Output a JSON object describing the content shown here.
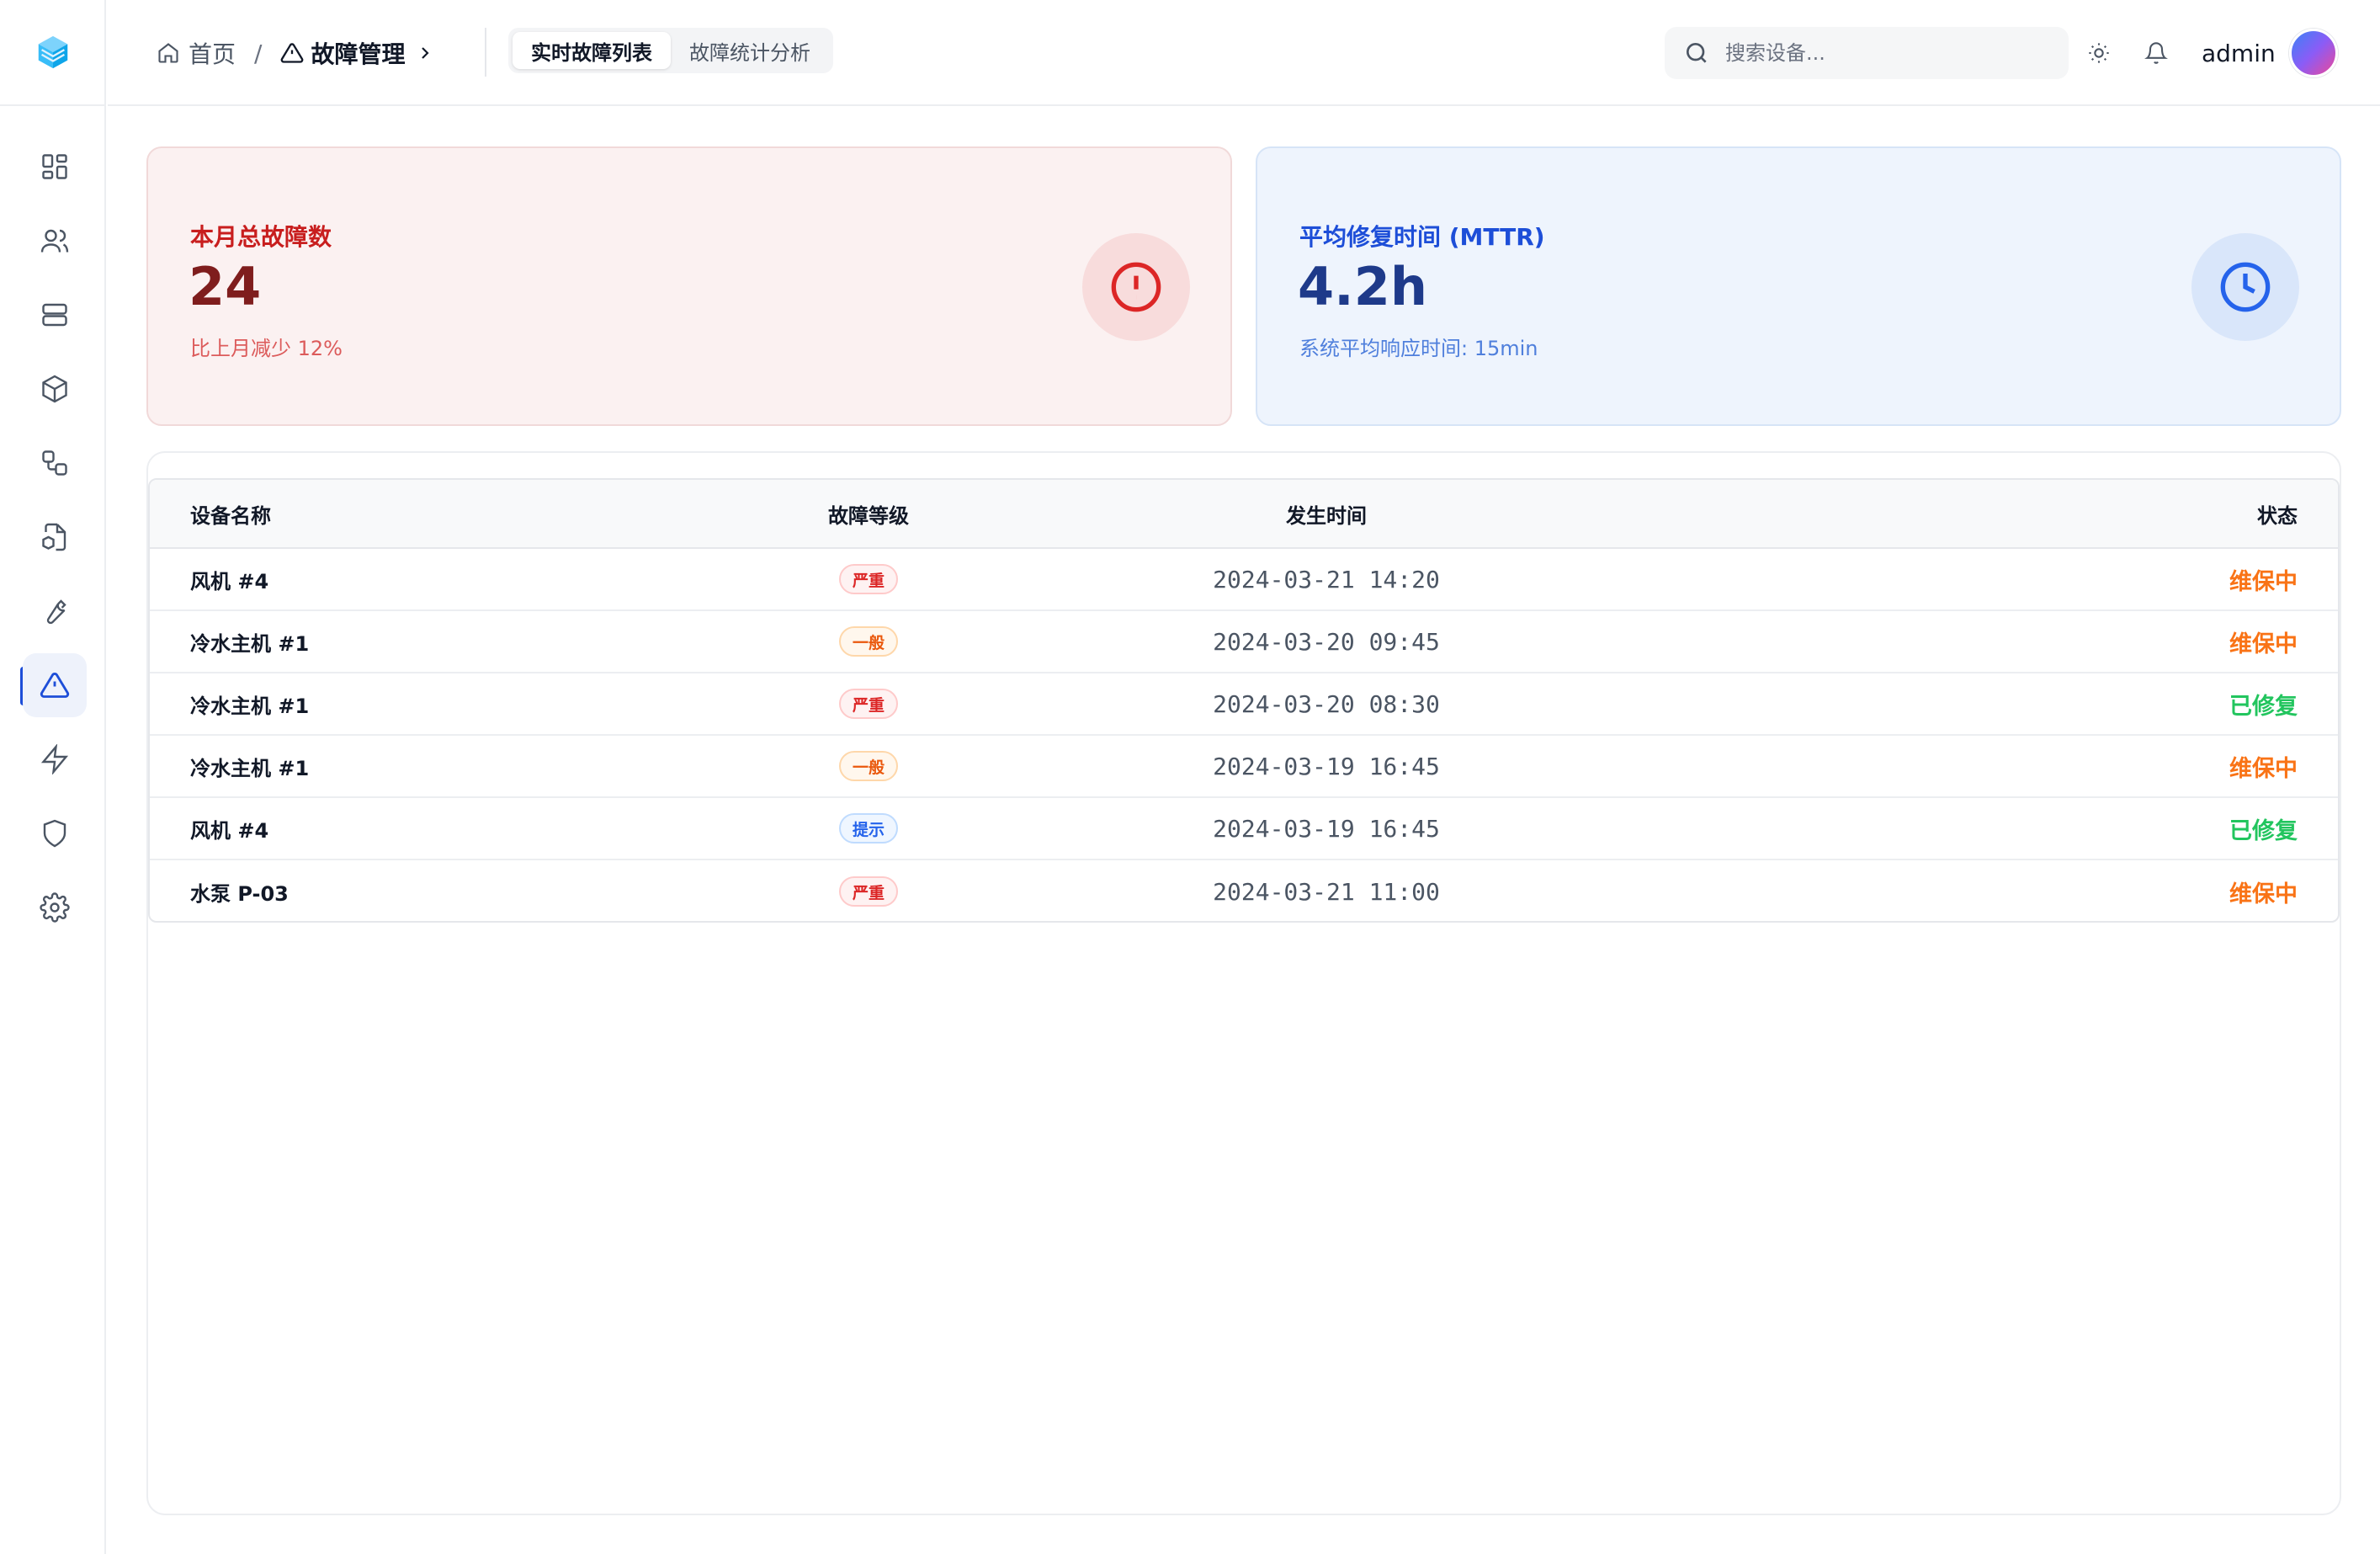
{
  "breadcrumb": {
    "home": "首页",
    "separator": "/",
    "current": "故障管理"
  },
  "tabs": [
    {
      "label": "实时故障列表",
      "active": true
    },
    {
      "label": "故障统计分析",
      "active": false
    }
  ],
  "search": {
    "placeholder": "搜索设备..."
  },
  "user": {
    "name": "admin"
  },
  "sidebar": {
    "icons": [
      "dashboard-icon",
      "users-icon",
      "server-icon",
      "box-icon",
      "workflow-icon",
      "file-box-icon",
      "wrench-icon",
      "alert-triangle-icon",
      "zap-icon",
      "shield-icon",
      "settings-icon"
    ],
    "active": "alert-triangle-icon"
  },
  "stats": {
    "faults": {
      "label": "本月总故障数",
      "value": "24",
      "sub": "比上月减少 12%"
    },
    "mttr": {
      "label": "平均修复时间 (MTTR)",
      "value": "4.2h",
      "sub": "系统平均响应时间: 15min"
    }
  },
  "table": {
    "headers": {
      "name": "设备名称",
      "level": "故障等级",
      "time": "发生时间",
      "status": "状态"
    },
    "rows": [
      {
        "name": "风机 #4",
        "level": "严重",
        "levelType": "severe",
        "time": "2024-03-21 14:20",
        "status": "维保中",
        "statusType": "maint"
      },
      {
        "name": "冷水主机 #1",
        "level": "一般",
        "levelType": "normal",
        "time": "2024-03-20 09:45",
        "status": "维保中",
        "statusType": "maint"
      },
      {
        "name": "冷水主机 #1",
        "level": "严重",
        "levelType": "severe",
        "time": "2024-03-20 08:30",
        "status": "已修复",
        "statusType": "fixed"
      },
      {
        "name": "冷水主机 #1",
        "level": "一般",
        "levelType": "normal",
        "time": "2024-03-19 16:45",
        "status": "维保中",
        "statusType": "maint"
      },
      {
        "name": "风机 #4",
        "level": "提示",
        "levelType": "hint",
        "time": "2024-03-19 16:45",
        "status": "已修复",
        "statusType": "fixed"
      },
      {
        "name": "水泵 P-03",
        "level": "严重",
        "levelType": "severe",
        "time": "2024-03-21 11:00",
        "status": "维保中",
        "statusType": "maint"
      }
    ]
  },
  "colors": {
    "severe": {
      "fg": "#dc2626",
      "bg": "#fef2f2",
      "border": "#fecaca"
    },
    "normal": {
      "fg": "#ea580c",
      "bg": "#fff7ed",
      "border": "#fed7aa"
    },
    "hint": {
      "fg": "#2563eb",
      "bg": "#eff6ff",
      "border": "#bfdbfe"
    },
    "maint": "#f97316",
    "fixed": "#22c55e",
    "accent": "#1d4ed8"
  }
}
